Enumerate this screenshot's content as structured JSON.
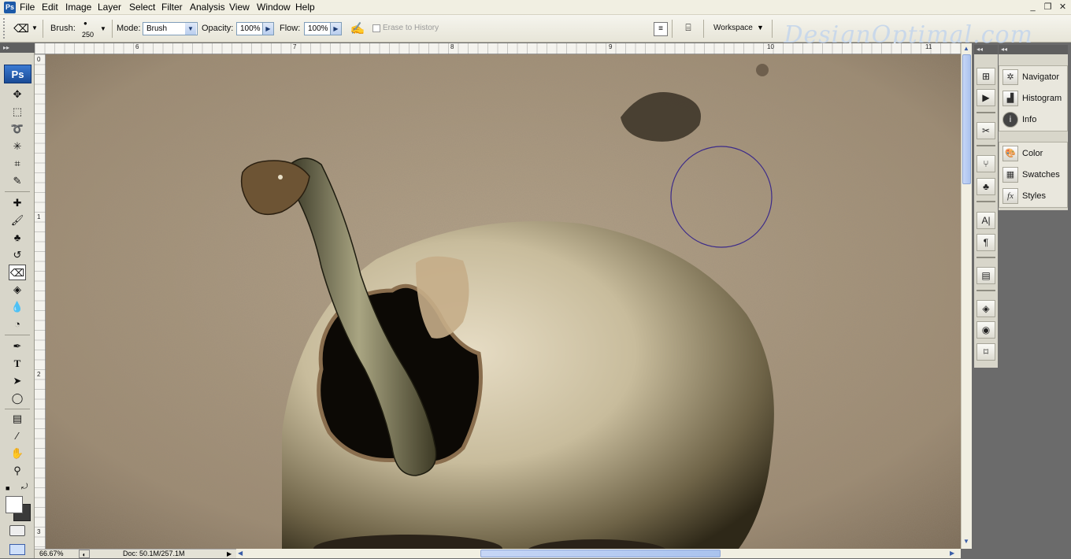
{
  "app": {
    "mini_logo": "Ps",
    "badge": "Ps"
  },
  "menu": [
    "File",
    "Edit",
    "Image",
    "Layer",
    "Select",
    "Filter",
    "Analysis",
    "View",
    "Window",
    "Help"
  ],
  "window_controls": {
    "minimize": "_",
    "restore": "❐",
    "close": "✕"
  },
  "options": {
    "brush_label": "Brush:",
    "brush_size": "250",
    "mode_label": "Mode:",
    "mode_value": "Brush",
    "opacity_label": "Opacity:",
    "opacity_value": "100%",
    "flow_label": "Flow:",
    "flow_value": "100%",
    "erase_history_label": "Erase to History",
    "workspace_label": "Workspace"
  },
  "watermark": "DesignOptimal.com",
  "ruler_top": [
    "6",
    "7",
    "8",
    "9",
    "10",
    "11"
  ],
  "ruler_left": [
    "0",
    "1",
    "2",
    "3"
  ],
  "status": {
    "zoom": "66.67%",
    "doc": "Doc: 50.1M/257.1M"
  },
  "panels": {
    "group1": [
      "Navigator",
      "Histogram",
      "Info"
    ],
    "group2": [
      "Color",
      "Swatches",
      "Styles"
    ]
  },
  "tools": [
    "move-tool",
    "marquee-tool",
    "lasso-tool",
    "magic-wand-tool",
    "crop-tool",
    "slice-tool",
    "healing-brush-tool",
    "brush-tool",
    "clone-stamp-tool",
    "history-brush-tool",
    "eraser-tool",
    "paint-bucket-tool",
    "blur-tool",
    "dodge-tool",
    "pen-tool",
    "type-tool",
    "path-selection-tool",
    "shape-tool",
    "notes-tool",
    "eyedropper-tool",
    "hand-tool",
    "zoom-tool"
  ]
}
